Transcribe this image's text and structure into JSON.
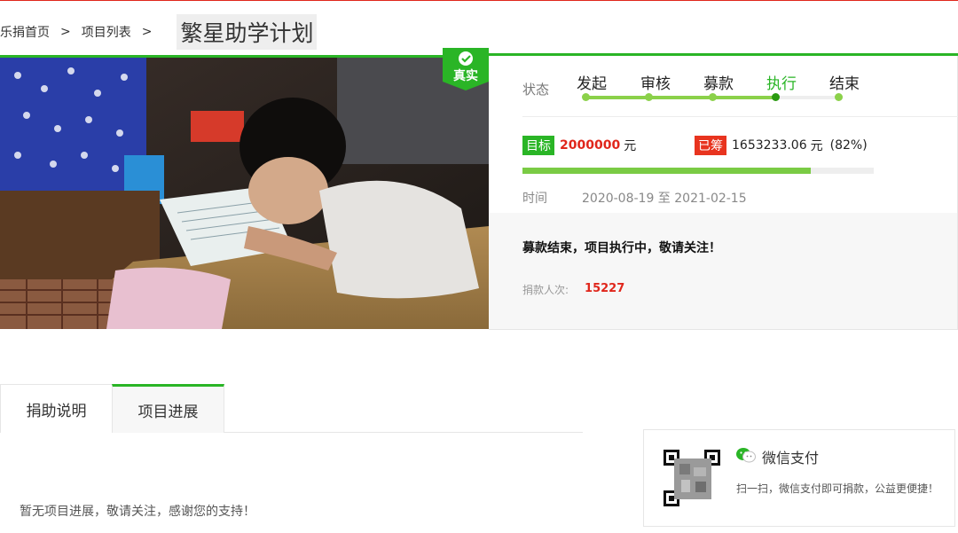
{
  "breadcrumb": {
    "home": "乐捐首页",
    "sep1": ">",
    "list": "项目列表",
    "sep2": ">",
    "title": "繁星助学计划"
  },
  "badge": {
    "label": "真实"
  },
  "status": {
    "label": "状态",
    "steps": [
      "发起",
      "审核",
      "募款",
      "执行",
      "结束"
    ],
    "current_step": "执行"
  },
  "funding": {
    "goal_tag": "目标",
    "goal_value": "2000000",
    "goal_unit": "元",
    "raised_tag": "已筹",
    "raised_value": "1653233.06",
    "raised_unit": "元",
    "raised_percent": "(82%)",
    "progress_fraction": 0.82
  },
  "time": {
    "label": "时间",
    "range": "2020-08-19 至 2021-02-15"
  },
  "notice": "募款结束，项目执行中，敬请关注！",
  "donors": {
    "label": "捐款人次:",
    "count": "15227"
  },
  "tabs": [
    "捐助说明",
    "项目进展"
  ],
  "active_tab": "项目进展",
  "progress_message": "暂无项目进展，敬请关注，感谢您的支持！",
  "wechat": {
    "title": "微信支付",
    "description": "扫一扫，微信支付即可捐款，公益更便捷！",
    "icon": "wechat-icon"
  },
  "colors": {
    "accent_green": "#2ab526",
    "accent_red": "#e0261b"
  }
}
